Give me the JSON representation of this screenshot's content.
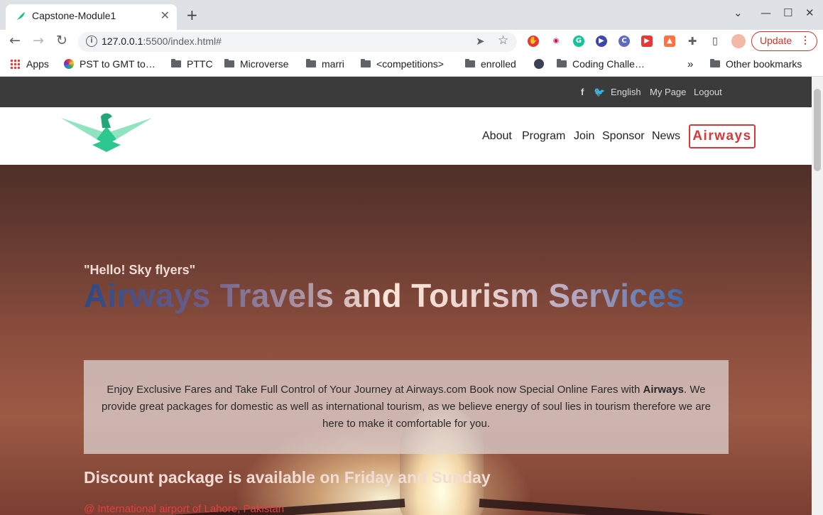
{
  "browser": {
    "tab_title": "Capstone-Module1",
    "url_host": "127.0.0.1",
    "url_rest": ":5500/index.html#",
    "update_label": "Update",
    "bookmarks": [
      "Apps",
      "PST to GMT to…",
      "PTTC",
      "Microverse",
      "marri",
      "<competitions>",
      "enrolled",
      "Coding Challe…",
      "Other bookmarks"
    ],
    "overflow": "»"
  },
  "site": {
    "topbar": {
      "english": "English",
      "mypage": "My Page",
      "logout": "Logout"
    },
    "menu": [
      "About",
      "Program",
      "Join",
      "Sponsor",
      "News"
    ],
    "brand": "Airways",
    "hero": {
      "greeting": "\"Hello! Sky flyers\"",
      "title": "Airways Travels and Tourism Services",
      "description_1": "Enjoy Exclusive Fares and Take Full Control of Your Journey at Airways.com Book now Special Online Fares with ",
      "description_bold": "Airways",
      "description_2": ". We provide great packages for domestic as well as international tourism, as we believe energy of soul lies in tourism therefore we are here to make it comfortable for you.",
      "discount": "Discount package is available on Friday and Sunday",
      "location": "@ International airport of Lahore, Pakistan"
    }
  },
  "colors": {
    "accent": "#d93838",
    "topbar": "#3b3b3b",
    "logo": "#2ec78f"
  }
}
